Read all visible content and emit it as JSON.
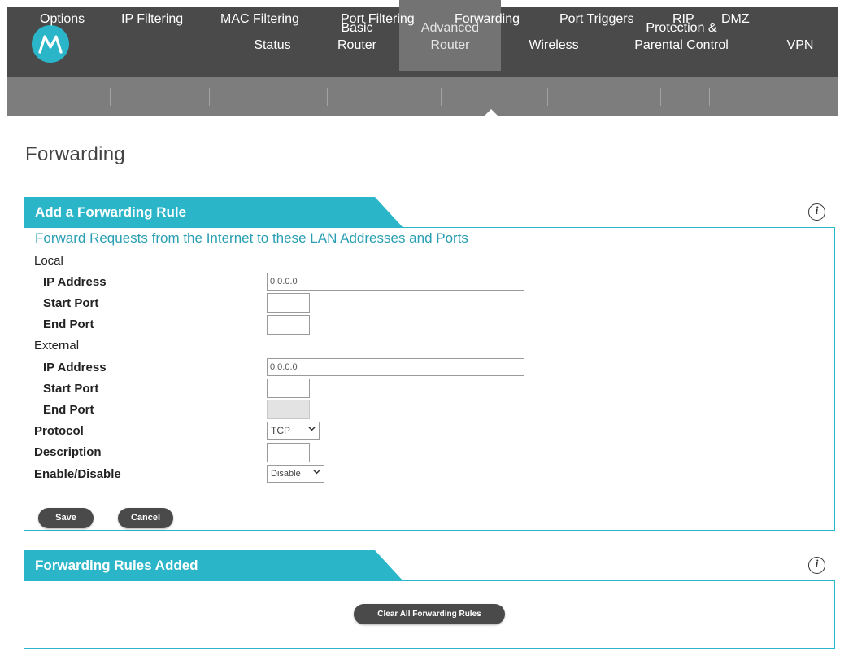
{
  "nav": {
    "tabs": [
      {
        "label": "Status"
      },
      {
        "label": "Basic\nRouter"
      },
      {
        "label": "Advanced\nRouter"
      },
      {
        "label": "Wireless"
      },
      {
        "label": "Protection &\nParental Control"
      },
      {
        "label": "VPN"
      }
    ],
    "active_tab": "Advanced Router",
    "subtabs": [
      {
        "label": "Options"
      },
      {
        "label": "IP Filtering"
      },
      {
        "label": "MAC Filtering"
      },
      {
        "label": "Port Filtering"
      },
      {
        "label": "Forwarding"
      },
      {
        "label": "Port Triggers"
      },
      {
        "label": "RIP"
      },
      {
        "label": "DMZ"
      }
    ],
    "active_subtab": "Forwarding"
  },
  "page_title": "Forwarding",
  "add_rule": {
    "header": "Add a Forwarding Rule",
    "subheading": "Forward Requests from the Internet to these LAN Addresses and Ports",
    "local_label": "Local",
    "local_ip_label": "IP Address",
    "local_ip_value": "0.0.0.0",
    "local_start_label": "Start Port",
    "local_start_value": "",
    "local_end_label": "End Port",
    "local_end_value": "",
    "external_label": "External",
    "external_ip_label": "IP Address",
    "external_ip_value": "0.0.0.0",
    "external_start_label": "Start Port",
    "external_start_value": "",
    "external_end_label": "End Port",
    "external_end_value": "",
    "protocol_label": "Protocol",
    "protocol_value": "TCP",
    "description_label": "Description",
    "description_value": "",
    "enable_label": "Enable/Disable",
    "enable_value": "Disable",
    "save_label": "Save",
    "cancel_label": "Cancel"
  },
  "rules_added": {
    "header": "Forwarding Rules Added",
    "clear_label": "Clear All Forwarding Rules"
  },
  "info_glyph": "i",
  "colors": {
    "accent": "#2ab5c9",
    "nav_bg": "#4a4a4a",
    "active_tab_bg": "#737373",
    "subnav_bg": "#7d7d7d",
    "button_bg": "#4a4a4a"
  }
}
